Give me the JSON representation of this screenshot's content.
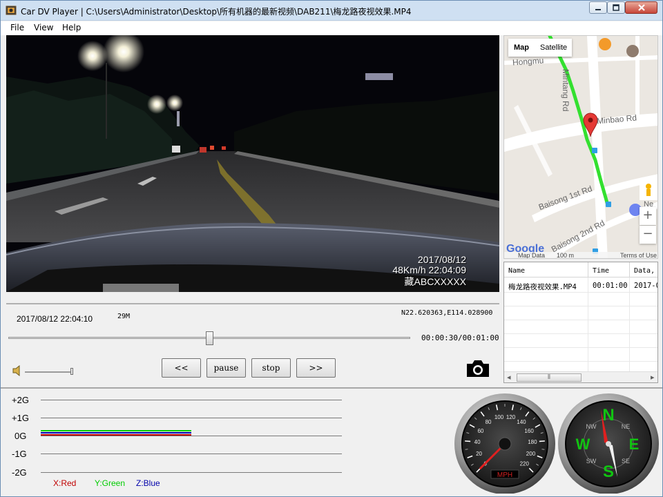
{
  "window": {
    "title": "Car DV Player | C:\\Users\\Administrator\\Desktop\\所有机器的最新视频\\DAB211\\梅龙路夜视效果.MP4"
  },
  "menu": [
    "File",
    "View",
    "Help"
  ],
  "video": {
    "osd_date": "2017/08/12",
    "osd_speed_time": "48Km/h 22:04:09",
    "osd_plate": "藏ABCXXXXX"
  },
  "map": {
    "tab_map": "Map",
    "tab_satellite": "Satellite",
    "roads": [
      "Hongmu",
      "Mintang Rd",
      "Minbao Rd",
      "Baisong 1st Rd",
      "Baisong 2nd Rd"
    ],
    "footer_data": "Map Data",
    "footer_scale": "100 m",
    "footer_terms": "Terms of Use",
    "zoom_in": "+",
    "zoom_out": "−",
    "logo": "Google",
    "partial_label": "Ne"
  },
  "file_table": {
    "columns": [
      "Name",
      "Time",
      "Data, t"
    ],
    "rows": [
      {
        "name": "梅龙路夜视效果.MP4",
        "time": "00:01:00",
        "date": "2017-0"
      }
    ],
    "scroll_left": "◂",
    "scroll_right": "▸",
    "scroll_grip": "⦀"
  },
  "playback": {
    "datetime": "2017/08/12 22:04:10",
    "file_size": "29M",
    "gps": "N22.620363,E114.028900",
    "time_position": "00:00:30/00:01:00",
    "progress": 0.5,
    "volume": 1.0,
    "buttons": {
      "rewind": "<<",
      "pause": "pause",
      "stop": "stop",
      "forward": ">>"
    }
  },
  "gsensor": {
    "y_labels": [
      "+2G",
      "+1G",
      "0G",
      "-1G",
      "-2G"
    ],
    "legend": {
      "x": "X:Red",
      "y": "Y:Green",
      "z": "Z:Blue"
    },
    "colors": {
      "x": "#c00000",
      "y": "#00cc00",
      "z": "#0000aa"
    }
  },
  "speedometer": {
    "ticks": [
      "0",
      "20",
      "40",
      "60",
      "80",
      "100",
      "120",
      "140",
      "160",
      "180",
      "200",
      "220"
    ],
    "unit": "MPH",
    "needle_value": 0
  },
  "compass": {
    "cardinals": {
      "n": "N",
      "e": "E",
      "s": "S",
      "w": "W"
    },
    "intercardinals": {
      "ne": "NE",
      "se": "SE",
      "sw": "SW",
      "nw": "NW"
    }
  },
  "colors": {
    "track": "#33e02f",
    "title_bar": "#cfe0f2",
    "compass_text": "#11c411"
  }
}
